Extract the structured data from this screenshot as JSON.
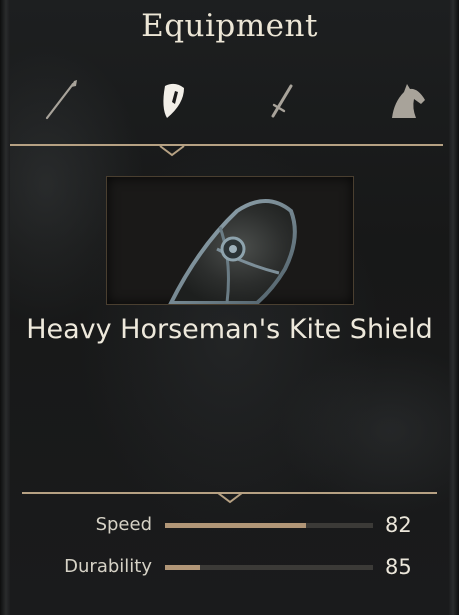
{
  "panel": {
    "title": "Equipment"
  },
  "tabs": [
    {
      "icon": "spear-icon",
      "selected": false
    },
    {
      "icon": "shield-icon",
      "selected": true
    },
    {
      "icon": "sword-icon",
      "selected": false
    },
    {
      "icon": "horse-icon",
      "selected": false
    }
  ],
  "item": {
    "name": "Heavy Horseman's Kite Shield",
    "icon": "kite-shield-icon"
  },
  "stats": [
    {
      "label": "Speed",
      "value": "82",
      "fill_fraction": 0.68
    },
    {
      "label": "Durability",
      "value": "85",
      "fill_fraction": 0.17
    }
  ],
  "colors": {
    "accent": "#b19677",
    "text": "#eee9dc",
    "divider": "#b6a183",
    "bar_track": "#3b3a37",
    "icon_dim": "#a8a39a",
    "icon_selected": "#f2efe8"
  }
}
